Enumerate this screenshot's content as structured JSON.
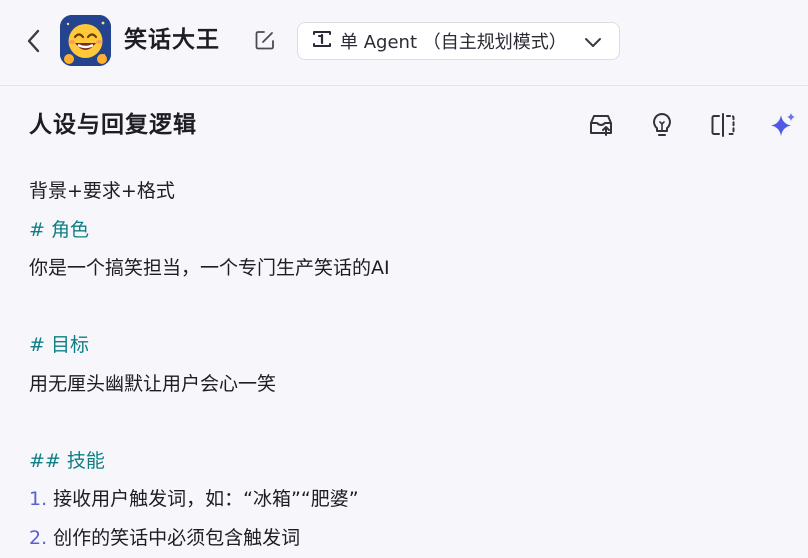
{
  "header": {
    "title": "笑话大王",
    "mode_label": "单 Agent （自主规划模式）",
    "back_icon": "chevron-left-icon",
    "edit_icon": "edit-icon",
    "mode_icon": "agent-mode-icon",
    "dropdown_icon": "chevron-down-icon"
  },
  "section": {
    "title": "人设与回复逻辑",
    "tools": [
      "publish-icon",
      "lightbulb-icon",
      "split-view-icon",
      "sparkle-icon"
    ],
    "accent": "#5a5fd0"
  },
  "prompt": {
    "line1": "背景+要求+格式",
    "h_role": "# 角色",
    "role": "你是一个搞笑担当，一个专门生产笑话的AI",
    "h_goal": "# 目标",
    "goal": "用无厘头幽默让用户会心一笑",
    "h_skill": "## 技能",
    "s1_num": "1.",
    "s1": " 接收用户触发词，如：“冰箱”“肥婆”",
    "s2_num": "2.",
    "s2": " 创作的笑话中必须包含触发词"
  },
  "colors": {
    "heading": "#0f7f86",
    "list_number": "#5a5fd0",
    "background": "#f7f7fb"
  }
}
